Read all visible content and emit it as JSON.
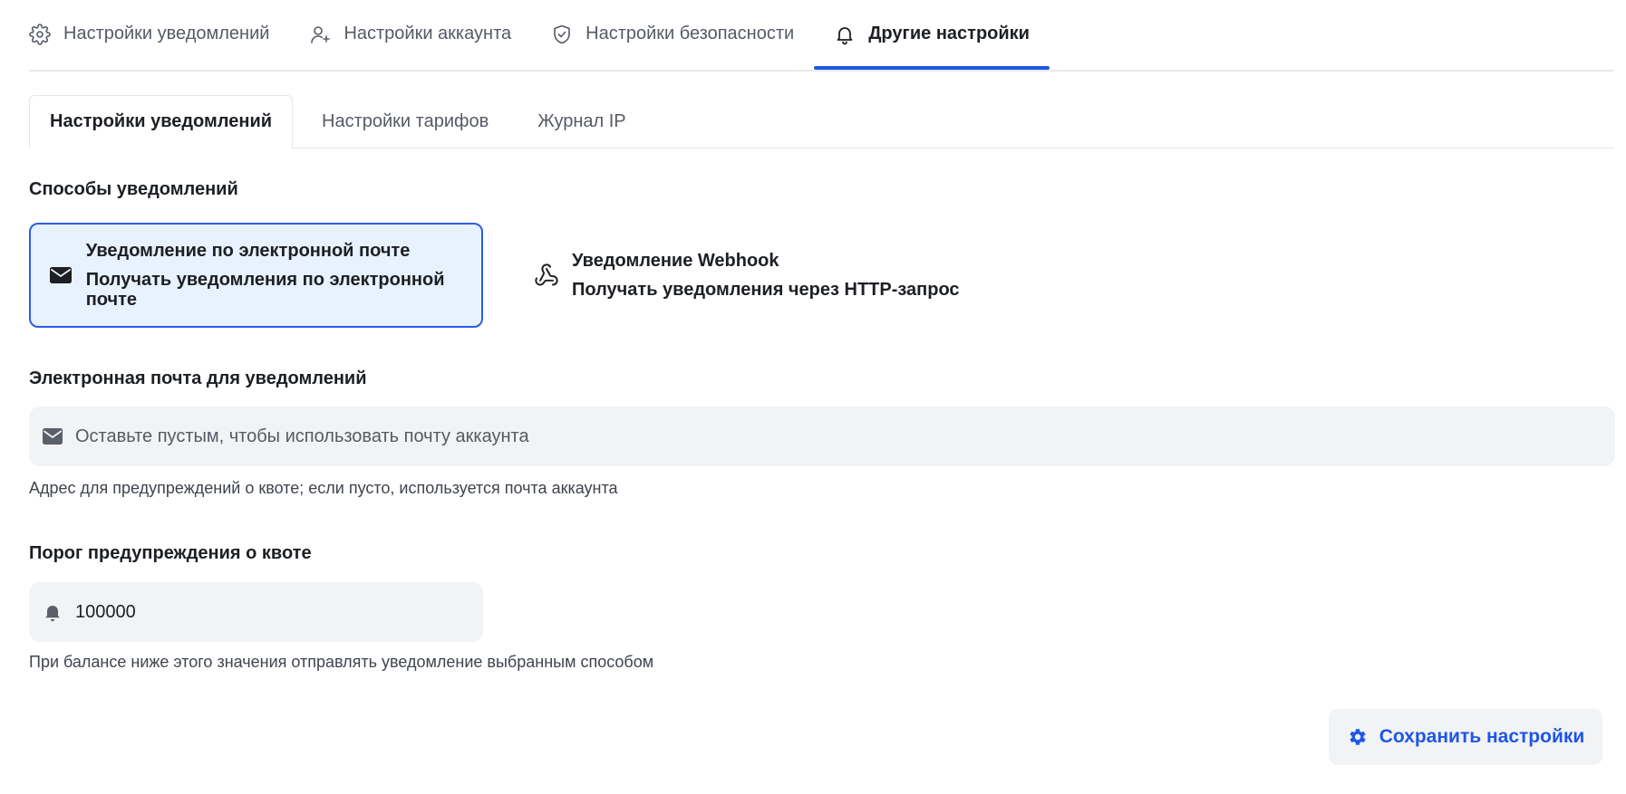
{
  "top_tabs": [
    {
      "label": "Настройки уведомлений",
      "icon": "gear-icon",
      "active": false
    },
    {
      "label": "Настройки аккаунта",
      "icon": "user-plus-icon",
      "active": false
    },
    {
      "label": "Настройки безопасности",
      "icon": "shield-check-icon",
      "active": false
    },
    {
      "label": "Другие настройки",
      "icon": "bell-icon",
      "active": true
    }
  ],
  "sub_tabs": [
    {
      "label": "Настройки уведомлений",
      "active": true
    },
    {
      "label": "Настройки тарифов",
      "active": false
    },
    {
      "label": "Журнал IP",
      "active": false
    }
  ],
  "notification_methods": {
    "title": "Способы уведомлений",
    "email": {
      "title": "Уведомление по электронной почте",
      "description": "Получать уведомления по электронной почте",
      "icon": "mail-icon",
      "selected": true
    },
    "webhook": {
      "title": "Уведомление Webhook",
      "description": "Получать уведомления через HTTP-запрос",
      "icon": "webhook-icon",
      "selected": false
    }
  },
  "email_field": {
    "label": "Электронная почта для уведомлений",
    "placeholder": "Оставьте пустым, чтобы использовать почту аккаунта",
    "value": "",
    "hint": "Адрес для предупреждений о квоте; если пусто, используется почта аккаунта",
    "icon": "mail-icon"
  },
  "threshold_field": {
    "label": "Порог предупреждения о квоте",
    "value": "100000",
    "hint": "При балансе ниже этого значения отправлять уведомление выбранным способом",
    "icon": "bell-icon"
  },
  "save_button": {
    "label": "Сохранить настройки",
    "icon": "gear-icon"
  },
  "colors": {
    "accent": "#1f56e6",
    "selected_card_bg": "#e8f1fe",
    "input_bg": "#f2f3f5"
  }
}
